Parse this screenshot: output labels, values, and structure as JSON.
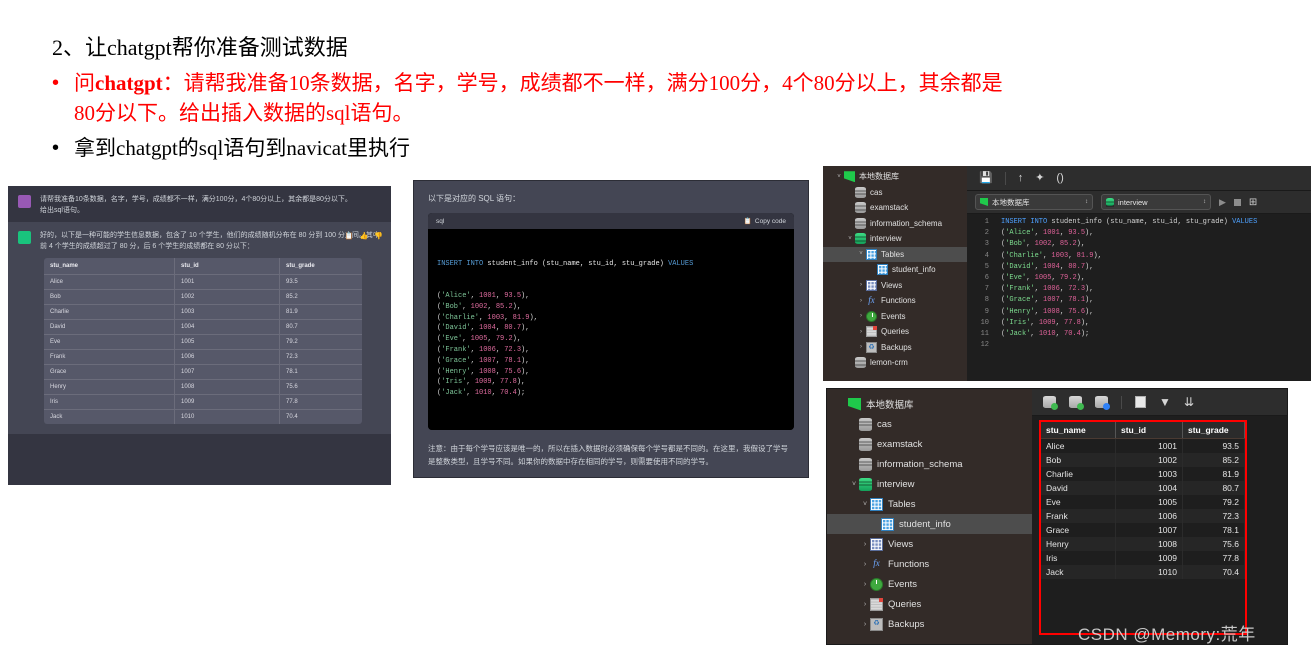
{
  "slide": {
    "heading": "2、让chatgpt帮你准备测试数据",
    "bullet1_prefix": "问",
    "bullet1_bold": "chatgpt",
    "bullet1_rest": "：请帮我准备10条数据，名字，学号，成绩都不一样，满分100分，4个80分以上，其余都是",
    "bullet1_line2": "80分以下。给出插入数据的sql语句。",
    "bullet2": "拿到chatgpt的sql语句到navicat里执行",
    "bullet_marker": "•",
    "accent_red": "#ff0000"
  },
  "chat": {
    "user_message": "请帮我准备10条数据，名字，学号，成绩都不一样，满分100分，4个80分以上，其余都是80分以下。\n给出sql语句。",
    "bot_message": "好的，以下是一种可能的学生信息数据，包含了 10 个学生，他们的成绩随机分布在 80 分到 100 分之间。其中前 4 个学生的成绩超过了 80 分，后 6 个学生的成绩都在 80 分以下：",
    "actions": [
      "copy-icon",
      "thumbs-up-icon",
      "thumbs-down-icon"
    ],
    "table": {
      "columns": [
        "stu_name",
        "stu_id",
        "stu_grade"
      ],
      "rows": [
        [
          "Alice",
          "1001",
          "93.5"
        ],
        [
          "Bob",
          "1002",
          "85.2"
        ],
        [
          "Charlie",
          "1003",
          "81.9"
        ],
        [
          "David",
          "1004",
          "80.7"
        ],
        [
          "Eve",
          "1005",
          "79.2"
        ],
        [
          "Frank",
          "1006",
          "72.3"
        ],
        [
          "Grace",
          "1007",
          "78.1"
        ],
        [
          "Henry",
          "1008",
          "75.6"
        ],
        [
          "Iris",
          "1009",
          "77.8"
        ],
        [
          "Jack",
          "1010",
          "70.4"
        ]
      ]
    }
  },
  "answer": {
    "intro": "以下是对应的 SQL 语句：",
    "code_lang": "sql",
    "copy_label": "Copy code",
    "sql_header_keyword": "INSERT INTO",
    "sql_table": "student_info",
    "sql_columns": "(stu_name, stu_id, stu_grade)",
    "sql_values_keyword": "VALUES",
    "sql_rows": [
      {
        "name": "'Alice'",
        "id": "1001",
        "grade": "93.5",
        "end": ","
      },
      {
        "name": "'Bob'",
        "id": "1002",
        "grade": "85.2",
        "end": ","
      },
      {
        "name": "'Charlie'",
        "id": "1003",
        "grade": "81.9",
        "end": ","
      },
      {
        "name": "'David'",
        "id": "1004",
        "grade": "80.7",
        "end": ","
      },
      {
        "name": "'Eve'",
        "id": "1005",
        "grade": "79.2",
        "end": ","
      },
      {
        "name": "'Frank'",
        "id": "1006",
        "grade": "72.3",
        "end": ","
      },
      {
        "name": "'Grace'",
        "id": "1007",
        "grade": "78.1",
        "end": ","
      },
      {
        "name": "'Henry'",
        "id": "1008",
        "grade": "75.6",
        "end": ","
      },
      {
        "name": "'Iris'",
        "id": "1009",
        "grade": "77.8",
        "end": ","
      },
      {
        "name": "'Jack'",
        "id": "1010",
        "grade": "70.4",
        "end": ";"
      }
    ],
    "note": "注意：由于每个学号应该是唯一的，所以在插入数据时必须确保每个学号都是不同的。在这里，我假设了学号是整数类型，且学号不同。如果你的数据中存在相同的学号，则需要使用不同的学号。"
  },
  "navicat_top": {
    "tree": [
      {
        "label": "本地数据库",
        "icon": "navicat-logo-icon",
        "twisty": "v",
        "indent": 0,
        "selected": false
      },
      {
        "label": "cas",
        "icon": "database-icon",
        "twisty": "",
        "indent": 1,
        "selected": false
      },
      {
        "label": "examstack",
        "icon": "database-icon",
        "twisty": "",
        "indent": 1,
        "selected": false
      },
      {
        "label": "information_schema",
        "icon": "database-icon",
        "twisty": "",
        "indent": 1,
        "selected": false
      },
      {
        "label": "interview",
        "icon": "database-active-icon",
        "twisty": "v",
        "indent": 1,
        "selected": false
      },
      {
        "label": "Tables",
        "icon": "tables-icon",
        "twisty": "v",
        "indent": 2,
        "selected": true
      },
      {
        "label": "student_info",
        "icon": "table-icon",
        "twisty": "",
        "indent": 3,
        "selected": false
      },
      {
        "label": "Views",
        "icon": "views-icon",
        "twisty": ">",
        "indent": 2,
        "selected": false
      },
      {
        "label": "Functions",
        "icon": "functions-icon",
        "twisty": ">",
        "indent": 2,
        "selected": false
      },
      {
        "label": "Events",
        "icon": "events-icon",
        "twisty": ">",
        "indent": 2,
        "selected": false
      },
      {
        "label": "Queries",
        "icon": "queries-icon",
        "twisty": ">",
        "indent": 2,
        "selected": false
      },
      {
        "label": "Backups",
        "icon": "backups-icon",
        "twisty": ">",
        "indent": 2,
        "selected": false
      },
      {
        "label": "lemon-crm",
        "icon": "database-icon",
        "twisty": "",
        "indent": 1,
        "selected": false
      }
    ],
    "toolbar_icons": [
      "save-icon",
      "beautify-icon",
      "format-icon",
      "parentheses-icon"
    ],
    "connection": "本地数据库",
    "database": "interview",
    "run_icon": "run-icon",
    "stop_icon": "stop-icon",
    "explain_icon": "explain-plan-icon",
    "editor_lines": [
      {
        "no": "1",
        "text": "INSERT INTO student_info (stu_name, stu_id, stu_grade) VALUES"
      },
      {
        "no": "2",
        "text": "('Alice', 1001, 93.5),"
      },
      {
        "no": "3",
        "text": "('Bob', 1002, 85.2),"
      },
      {
        "no": "4",
        "text": "('Charlie', 1003, 81.9),"
      },
      {
        "no": "5",
        "text": "('David', 1004, 80.7),"
      },
      {
        "no": "6",
        "text": "('Eve', 1005, 79.2),"
      },
      {
        "no": "7",
        "text": "('Frank', 1006, 72.3),"
      },
      {
        "no": "8",
        "text": "('Grace', 1007, 78.1),"
      },
      {
        "no": "9",
        "text": "('Henry', 1008, 75.6),"
      },
      {
        "no": "10",
        "text": "('Iris', 1009, 77.8),"
      },
      {
        "no": "11",
        "text": "('Jack', 1010, 70.4);"
      },
      {
        "no": "12",
        "text": ""
      }
    ]
  },
  "navicat_bottom": {
    "tree": [
      {
        "label": "本地数据库",
        "icon": "navicat-logo-icon",
        "twisty": "",
        "indent": 0,
        "selected": false
      },
      {
        "label": "cas",
        "icon": "database-icon",
        "twisty": "",
        "indent": 1,
        "selected": false
      },
      {
        "label": "examstack",
        "icon": "database-icon",
        "twisty": "",
        "indent": 1,
        "selected": false
      },
      {
        "label": "information_schema",
        "icon": "database-icon",
        "twisty": "",
        "indent": 1,
        "selected": false
      },
      {
        "label": "interview",
        "icon": "database-active-icon",
        "twisty": "v",
        "indent": 1,
        "selected": false
      },
      {
        "label": "Tables",
        "icon": "tables-icon",
        "twisty": "v",
        "indent": 2,
        "selected": false
      },
      {
        "label": "student_info",
        "icon": "table-icon",
        "twisty": "",
        "indent": 3,
        "selected": true
      },
      {
        "label": "Views",
        "icon": "views-icon",
        "twisty": ">",
        "indent": 2,
        "selected": false
      },
      {
        "label": "Functions",
        "icon": "functions-icon",
        "twisty": ">",
        "indent": 2,
        "selected": false
      },
      {
        "label": "Events",
        "icon": "events-icon",
        "twisty": ">",
        "indent": 2,
        "selected": false
      },
      {
        "label": "Queries",
        "icon": "queries-icon",
        "twisty": ">",
        "indent": 2,
        "selected": false
      },
      {
        "label": "Backups",
        "icon": "backups-icon",
        "twisty": ">",
        "indent": 2,
        "selected": false
      }
    ],
    "toolbar_icons": [
      "new-connection-icon",
      "open-connection-icon",
      "connection-info-icon",
      "new-document-icon",
      "filter-icon",
      "sort-icon"
    ],
    "grid": {
      "columns": [
        "stu_name",
        "stu_id",
        "stu_grade"
      ],
      "rows": [
        [
          "Alice",
          "1001",
          "93.5"
        ],
        [
          "Bob",
          "1002",
          "85.2"
        ],
        [
          "Charlie",
          "1003",
          "81.9"
        ],
        [
          "David",
          "1004",
          "80.7"
        ],
        [
          "Eve",
          "1005",
          "79.2"
        ],
        [
          "Frank",
          "1006",
          "72.3"
        ],
        [
          "Grace",
          "1007",
          "78.1"
        ],
        [
          "Henry",
          "1008",
          "75.6"
        ],
        [
          "Iris",
          "1009",
          "77.8"
        ],
        [
          "Jack",
          "1010",
          "70.4"
        ]
      ]
    },
    "highlight_color": "#ff0000"
  },
  "watermark": "CSDN @Memory:荒年"
}
